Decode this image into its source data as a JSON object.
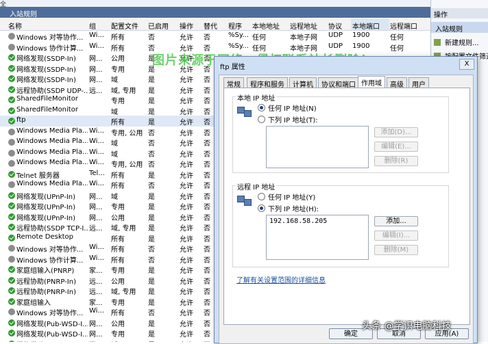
{
  "topstrip": {
    "label": "全"
  },
  "pane": {
    "title": "入站规则"
  },
  "columns": [
    "名称",
    "组",
    "配置文件",
    "已启用",
    "操作",
    "替代",
    "程序",
    "本地地址",
    "远程地址",
    "协议",
    "本地端口",
    "远程端口"
  ],
  "rows": [
    {
      "name": "Windows 对等协作...",
      "group": "Wi...",
      "profile": "所有",
      "enabled": "否",
      "action": "允许",
      "override": "否",
      "program": "%Sy...",
      "local": "任何",
      "remote": "本地子网",
      "protocol": "UDP",
      "lport": "1900",
      "rport": "任何",
      "on": false
    },
    {
      "name": "Windows 协作计算...",
      "group": "Wi...",
      "profile": "所有",
      "enabled": "否",
      "action": "允许",
      "override": "否",
      "program": "%Sy...",
      "local": "任何",
      "remote": "本地子网",
      "protocol": "UDP",
      "lport": "1900",
      "rport": "任何",
      "on": false
    },
    {
      "name": "网络发现(SSDP-In)",
      "group": "网...",
      "profile": "公用",
      "enabled": "是",
      "action": "允许",
      "override": "否",
      "program": "",
      "local": "",
      "remote": "",
      "protocol": "",
      "lport": "",
      "rport": "",
      "on": true
    },
    {
      "name": "网络发现(SSDP-In)",
      "group": "网...",
      "profile": "专用",
      "enabled": "是",
      "action": "允许",
      "override": "否",
      "program": "",
      "local": "",
      "remote": "",
      "protocol": "",
      "lport": "",
      "rport": "",
      "on": true
    },
    {
      "name": "网络发现(SSDP-In)",
      "group": "网...",
      "profile": "域",
      "enabled": "是",
      "action": "允许",
      "override": "否",
      "program": "",
      "local": "",
      "remote": "",
      "protocol": "",
      "lport": "",
      "rport": "",
      "on": true
    },
    {
      "name": "远程协助(SSDP UDP-...",
      "group": "远...",
      "profile": "域, 专用",
      "enabled": "是",
      "action": "允许",
      "override": "否",
      "program": "",
      "local": "",
      "remote": "",
      "protocol": "",
      "lport": "",
      "rport": "",
      "on": true
    },
    {
      "name": "SharedFileMonitor",
      "group": "",
      "profile": "专用",
      "enabled": "是",
      "action": "允许",
      "override": "否",
      "program": "",
      "local": "",
      "remote": "",
      "protocol": "",
      "lport": "",
      "rport": "",
      "on": true
    },
    {
      "name": "SharedFileMonitor",
      "group": "",
      "profile": "域",
      "enabled": "是",
      "action": "允许",
      "override": "否",
      "program": "",
      "local": "",
      "remote": "",
      "protocol": "",
      "lport": "",
      "rport": "",
      "on": true
    },
    {
      "name": "ftp",
      "group": "",
      "profile": "所有",
      "enabled": "是",
      "action": "允许",
      "override": "否",
      "program": "",
      "local": "",
      "remote": "",
      "protocol": "",
      "lport": "",
      "rport": "",
      "on": true,
      "sel": true
    },
    {
      "name": "Windows Media Pla...",
      "group": "Wi...",
      "profile": "专用, 公用",
      "enabled": "否",
      "action": "允许",
      "override": "否",
      "program": "",
      "local": "",
      "remote": "",
      "protocol": "",
      "lport": "",
      "rport": "",
      "on": false
    },
    {
      "name": "Windows Media Pla...",
      "group": "Wi...",
      "profile": "域",
      "enabled": "否",
      "action": "允许",
      "override": "否",
      "program": "",
      "local": "",
      "remote": "",
      "protocol": "",
      "lport": "",
      "rport": "",
      "on": false
    },
    {
      "name": "Windows Media Pla...",
      "group": "Wi...",
      "profile": "域",
      "enabled": "否",
      "action": "允许",
      "override": "否",
      "program": "",
      "local": "",
      "remote": "",
      "protocol": "",
      "lport": "",
      "rport": "",
      "on": false
    },
    {
      "name": "Windows Media Pla...",
      "group": "Wi...",
      "profile": "专用, 公用",
      "enabled": "否",
      "action": "允许",
      "override": "否",
      "program": "",
      "local": "",
      "remote": "",
      "protocol": "",
      "lport": "",
      "rport": "",
      "on": false
    },
    {
      "name": "Telnet 服务器",
      "group": "Tel...",
      "profile": "所有",
      "enabled": "是",
      "action": "允许",
      "override": "否",
      "program": "",
      "local": "",
      "remote": "",
      "protocol": "",
      "lport": "",
      "rport": "",
      "on": true
    },
    {
      "name": "Windows Media Pla...",
      "group": "Wi...",
      "profile": "所有",
      "enabled": "否",
      "action": "允许",
      "override": "否",
      "program": "",
      "local": "",
      "remote": "",
      "protocol": "",
      "lport": "",
      "rport": "",
      "on": false
    },
    {
      "name": "网络发现(UPnP-In)",
      "group": "网...",
      "profile": "域",
      "enabled": "是",
      "action": "允许",
      "override": "否",
      "program": "",
      "local": "",
      "remote": "",
      "protocol": "",
      "lport": "",
      "rport": "",
      "on": true
    },
    {
      "name": "网络发现(UPnP-In)",
      "group": "网...",
      "profile": "专用",
      "enabled": "是",
      "action": "允许",
      "override": "否",
      "program": "",
      "local": "",
      "remote": "",
      "protocol": "",
      "lport": "",
      "rport": "",
      "on": true
    },
    {
      "name": "网络发现(UPnP-In)",
      "group": "网...",
      "profile": "公用",
      "enabled": "是",
      "action": "允许",
      "override": "否",
      "program": "",
      "local": "",
      "remote": "",
      "protocol": "",
      "lport": "",
      "rport": "",
      "on": true
    },
    {
      "name": "远程协助(SSDP TCP-I...",
      "group": "远...",
      "profile": "域, 专用",
      "enabled": "是",
      "action": "允许",
      "override": "否",
      "program": "",
      "local": "",
      "remote": "",
      "protocol": "",
      "lport": "",
      "rport": "",
      "on": true
    },
    {
      "name": "Remote Desktop",
      "group": "",
      "profile": "所有",
      "enabled": "是",
      "action": "允许",
      "override": "否",
      "program": "",
      "local": "",
      "remote": "",
      "protocol": "",
      "lport": "",
      "rport": "",
      "on": true
    },
    {
      "name": "Windows 对等协作...",
      "group": "Wi...",
      "profile": "所有",
      "enabled": "否",
      "action": "允许",
      "override": "否",
      "program": "",
      "local": "",
      "remote": "",
      "protocol": "",
      "lport": "",
      "rport": "",
      "on": false
    },
    {
      "name": "Windows 协作计算...",
      "group": "Wi...",
      "profile": "所有",
      "enabled": "否",
      "action": "允许",
      "override": "否",
      "program": "",
      "local": "",
      "remote": "",
      "protocol": "",
      "lport": "",
      "rport": "",
      "on": false
    },
    {
      "name": "家庭组输入(PNRP)",
      "group": "家...",
      "profile": "专用",
      "enabled": "是",
      "action": "允许",
      "override": "否",
      "program": "",
      "local": "",
      "remote": "",
      "protocol": "",
      "lport": "",
      "rport": "",
      "on": true
    },
    {
      "name": "远程协助(PNRP-In)",
      "group": "远...",
      "profile": "公用",
      "enabled": "是",
      "action": "允许",
      "override": "否",
      "program": "",
      "local": "",
      "remote": "",
      "protocol": "",
      "lport": "",
      "rport": "",
      "on": true
    },
    {
      "name": "远程协助(PNRP-In)",
      "group": "远...",
      "profile": "域, 专用",
      "enabled": "是",
      "action": "允许",
      "override": "否",
      "program": "",
      "local": "",
      "remote": "",
      "protocol": "",
      "lport": "",
      "rport": "",
      "on": true
    },
    {
      "name": "家庭组输入",
      "group": "家...",
      "profile": "专用",
      "enabled": "是",
      "action": "允许",
      "override": "否",
      "program": "",
      "local": "",
      "remote": "",
      "protocol": "",
      "lport": "",
      "rport": "",
      "on": true
    },
    {
      "name": "Windows 对等协作...",
      "group": "Wi...",
      "profile": "所有",
      "enabled": "否",
      "action": "允许",
      "override": "否",
      "program": "",
      "local": "",
      "remote": "",
      "protocol": "",
      "lport": "",
      "rport": "",
      "on": false
    },
    {
      "name": "网络发现(Pub-WSD-I...",
      "group": "网...",
      "profile": "公用",
      "enabled": "是",
      "action": "允许",
      "override": "否",
      "program": "",
      "local": "",
      "remote": "",
      "protocol": "",
      "lport": "",
      "rport": "",
      "on": true
    },
    {
      "name": "网络发现(Pub-WSD-I...",
      "group": "网...",
      "profile": "专用",
      "enabled": "是",
      "action": "允许",
      "override": "否",
      "program": "",
      "local": "",
      "remote": "",
      "protocol": "",
      "lport": "",
      "rport": "",
      "on": true
    },
    {
      "name": "网络发现(Pub-WSD-I...",
      "group": "网...",
      "profile": "域",
      "enabled": "是",
      "action": "允许",
      "override": "否",
      "program": "",
      "local": "",
      "remote": "",
      "protocol": "",
      "lport": "",
      "rport": "",
      "on": true
    }
  ],
  "actions": {
    "title": "操作",
    "section": "入站规则",
    "items": [
      "新建规则...",
      "按配置文件筛选"
    ]
  },
  "watermark": "图片来源于网络，侵权联系站长删除！",
  "dialog": {
    "title": "ftp 属性",
    "close": "X",
    "tabs": [
      "常规",
      "程序和服务",
      "计算机",
      "协议和端口",
      "作用域",
      "高级",
      "用户"
    ],
    "active_tab": "作用域",
    "local": {
      "title": "本地 IP 地址",
      "any": "任何 IP 地址(N)",
      "these": "下列 IP 地址(T):",
      "add": "添加(D)...",
      "edit": "编辑(E)...",
      "remove": "删除(R)",
      "items": []
    },
    "remote": {
      "title": "远程 IP 地址",
      "any": "任何 IP 地址(Y)",
      "these": "下列 IP 地址(H):",
      "add": "添加...",
      "edit": "编辑(I)...",
      "remove": "删除(M)",
      "items": [
        "192.168.58.205"
      ]
    },
    "link": "了解有关设置范围的详细信息",
    "ok": "确定",
    "cancel": "取消",
    "apply": "应用(A)"
  },
  "credit": "头条 @学识电脑科技",
  "colors": {
    "header": "#4f6d9a",
    "enabled_icon": "#2f9a2f",
    "disabled_icon": "#8c8c8c",
    "dialog_frame": "#cfe0f4"
  }
}
